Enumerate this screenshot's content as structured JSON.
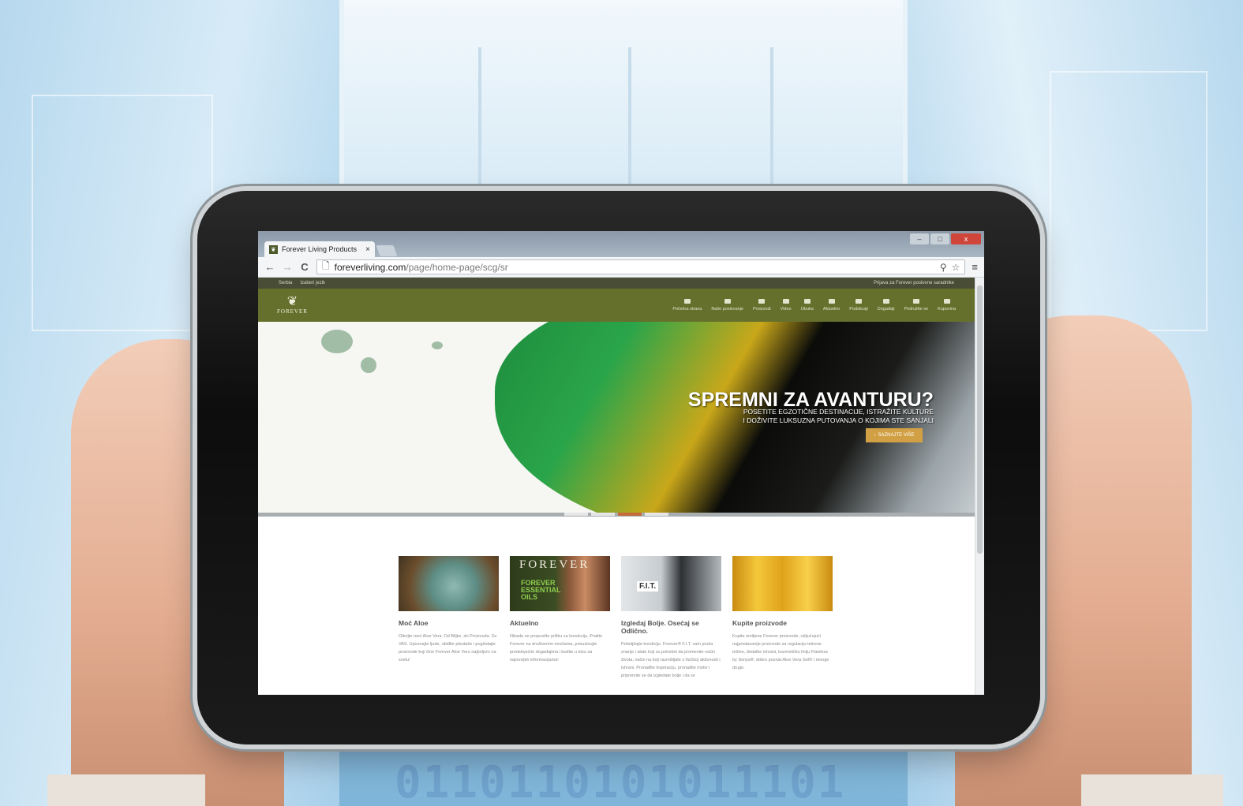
{
  "browser": {
    "tab_title": "Forever Living Products",
    "tab_close": "×",
    "url_host": "foreverliving.com",
    "url_path": "/page/home-page/scg/sr",
    "back_glyph": "←",
    "forward_glyph": "→",
    "reload_glyph": "C",
    "search_glyph": "⚲",
    "star_glyph": "☆",
    "menu_glyph": "≡",
    "min_glyph": "–",
    "max_glyph": "□",
    "close_glyph": "x",
    "page_glyph": "🗋"
  },
  "site": {
    "topbar": {
      "country": "Serbia",
      "language": "Izaberi jezik",
      "login": "Prijava za Forever poslovne saradnike"
    },
    "logo": {
      "mark": "❦",
      "text": "FOREVER"
    },
    "nav": [
      {
        "label": "Početna strana"
      },
      {
        "label": "Naše poslovanje"
      },
      {
        "label": "Proizvodi"
      },
      {
        "label": "Video"
      },
      {
        "label": "Obuka"
      },
      {
        "label": "Aktuelno"
      },
      {
        "label": "Podsticaji"
      },
      {
        "label": "Događaji"
      },
      {
        "label": "Pridružite se"
      },
      {
        "label": "Kupovina"
      }
    ],
    "hero": {
      "title": "SPREMNI ZA AVANTURU?",
      "line1": "POSETITE EGZOTIČNE DESTINACIJE, ISTRAŽITE KULTURE",
      "line2": "I DOŽIVITE LUKSUZNA PUTOVANJA O KOJIMA STE SANJALI",
      "cta": "SAZNAJTE VIŠE",
      "cta_arrow": "›"
    },
    "cards": [
      {
        "title": "Moć Aloe",
        "body": "Otkrijte moć Aloe Vera: Od Biljke, do Proizvoda. Za VAS. Upoznajte ljude, obiđite plantaže i pogledajte proizvode koji čine Forever Aloe Veru najboljom na svetu!"
      },
      {
        "title": "Aktuelno",
        "image_text": "FOREVER",
        "image_sub": "FOREVER ESSENTIAL OILS",
        "body": "Nikada ne propustite priliku za konekciju. Pratite Forever na društvenim mrežama, prisustvujte predstojećim događajima i budite u toku sa najnovijim informacijama!"
      },
      {
        "title": "Izgledaj Bolje. Osećaj se Odlično.",
        "image_badge": "F.I.T.",
        "body": "Poboljšajte kondiciju. Forever® F.I.T. vam pruža znanje i alate koji su potrebni da promenite način života, način na koji razmišljate o fizičkoj aktivnosti i ishrani. Pronađite inspiraciju, pronađite motiv i pripremite se da izgledate bolje i da se"
      },
      {
        "title": "Kupite proizvode",
        "body": "Kupite omiljene Forever proizvode, uključujući najprodavanije proizvode za regulaciju telesne težine, dodatke ishrani, kozmetičku liniju Flawless by Sonya®, dobro poznat Aloe Vera Gel® i mnoge druge."
      }
    ]
  },
  "background": {
    "binary": "0110110101011101"
  },
  "colors": {
    "nav_green": "#66702d",
    "topbar": "#4a4d35",
    "cta_gold": "#d1a044"
  }
}
